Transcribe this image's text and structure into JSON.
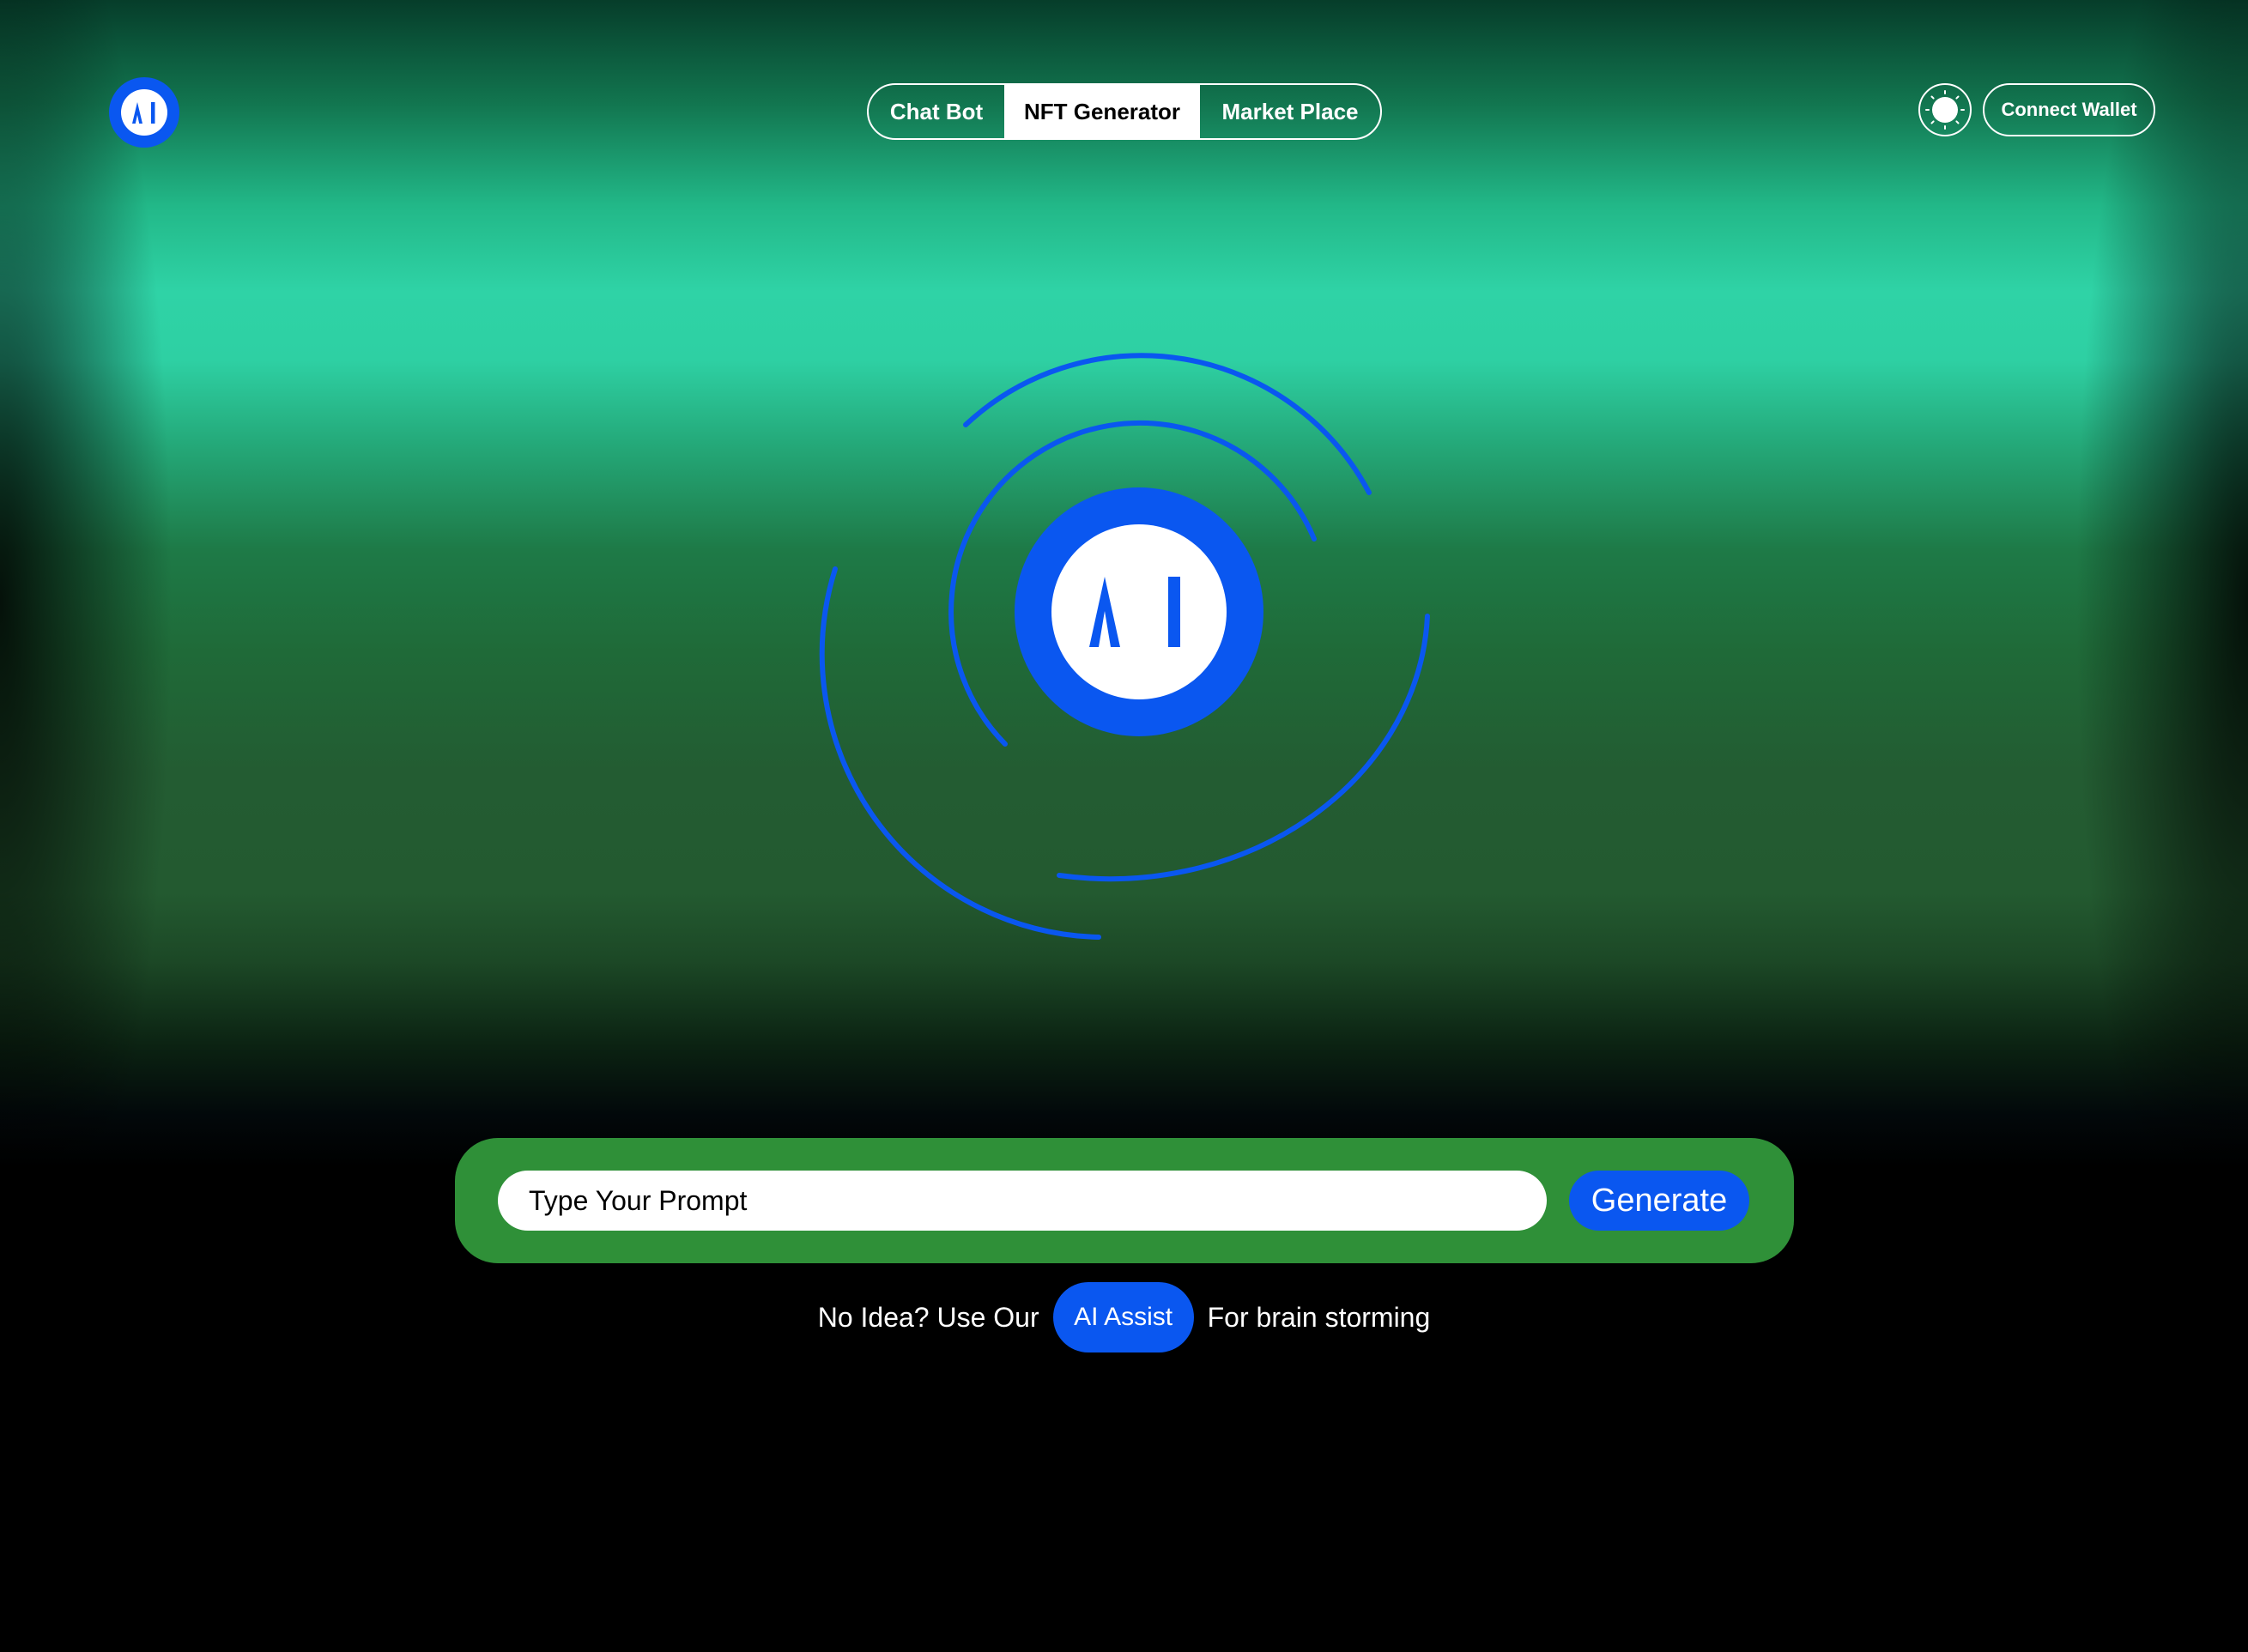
{
  "brand": {
    "logo_text": "AI",
    "accent_color": "#0a57f0"
  },
  "nav": {
    "tabs": [
      {
        "label": "Chat Bot",
        "active": false
      },
      {
        "label": "NFT Generator",
        "active": true
      },
      {
        "label": "Market Place",
        "active": false
      }
    ]
  },
  "header": {
    "theme_icon": "sun-icon",
    "connect_wallet_label": "Connect Wallet"
  },
  "hero": {
    "center_icon": "ai-logo-icon"
  },
  "prompt": {
    "placeholder": "Type Your Prompt",
    "value": "",
    "generate_label": "Generate",
    "bar_color": "#2f9038"
  },
  "hint": {
    "before": "No Idea? Use Our",
    "button_label": "AI Assist",
    "after": "For brain storming"
  }
}
